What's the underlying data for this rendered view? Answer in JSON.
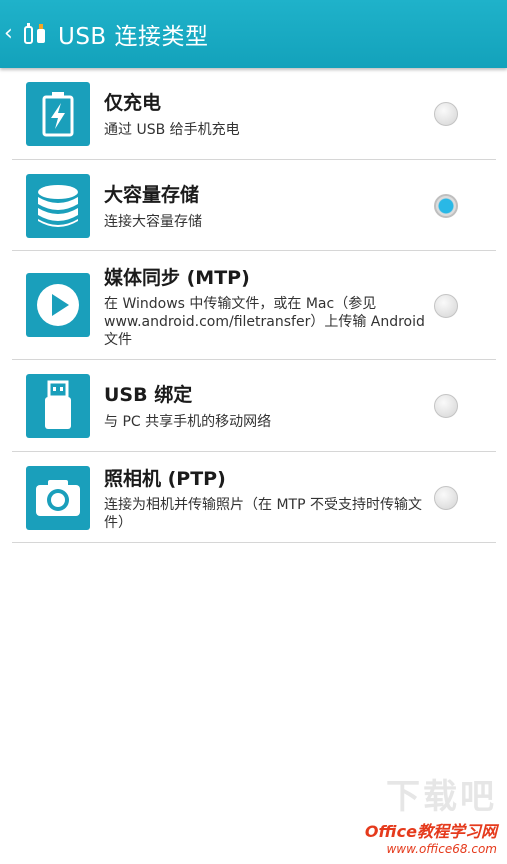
{
  "header": {
    "back_icon": "chevron-left-icon",
    "app_icon": "usb-cable-icon",
    "title": "USB 连接类型"
  },
  "items": [
    {
      "icon": "battery-charging-icon",
      "title": "仅充电",
      "desc": "通过 USB 给手机充电",
      "selected": false
    },
    {
      "icon": "database-storage-icon",
      "title": "大容量存储",
      "desc": "连接大容量存储",
      "selected": true
    },
    {
      "icon": "play-media-icon",
      "title": "媒体同步 (MTP)",
      "desc": "在 Windows 中传输文件，或在 Mac（参见 www.android.com/filetransfer）上传输 Android 文件",
      "selected": false
    },
    {
      "icon": "usb-drive-icon",
      "title": "USB 绑定",
      "desc": "与 PC 共享手机的移动网络",
      "selected": false
    },
    {
      "icon": "camera-icon",
      "title": "照相机 (PTP)",
      "desc": "连接为相机并传输照片（在 MTP 不受支持时传输文件）",
      "selected": false
    }
  ],
  "watermark": {
    "top": "下载吧",
    "line1": "Office教程学习网",
    "line2": "www.office68.com"
  },
  "colors": {
    "header": "#17a9c2",
    "icon_bg": "#1a9fbb",
    "radio_selected": "#29b8e6"
  }
}
